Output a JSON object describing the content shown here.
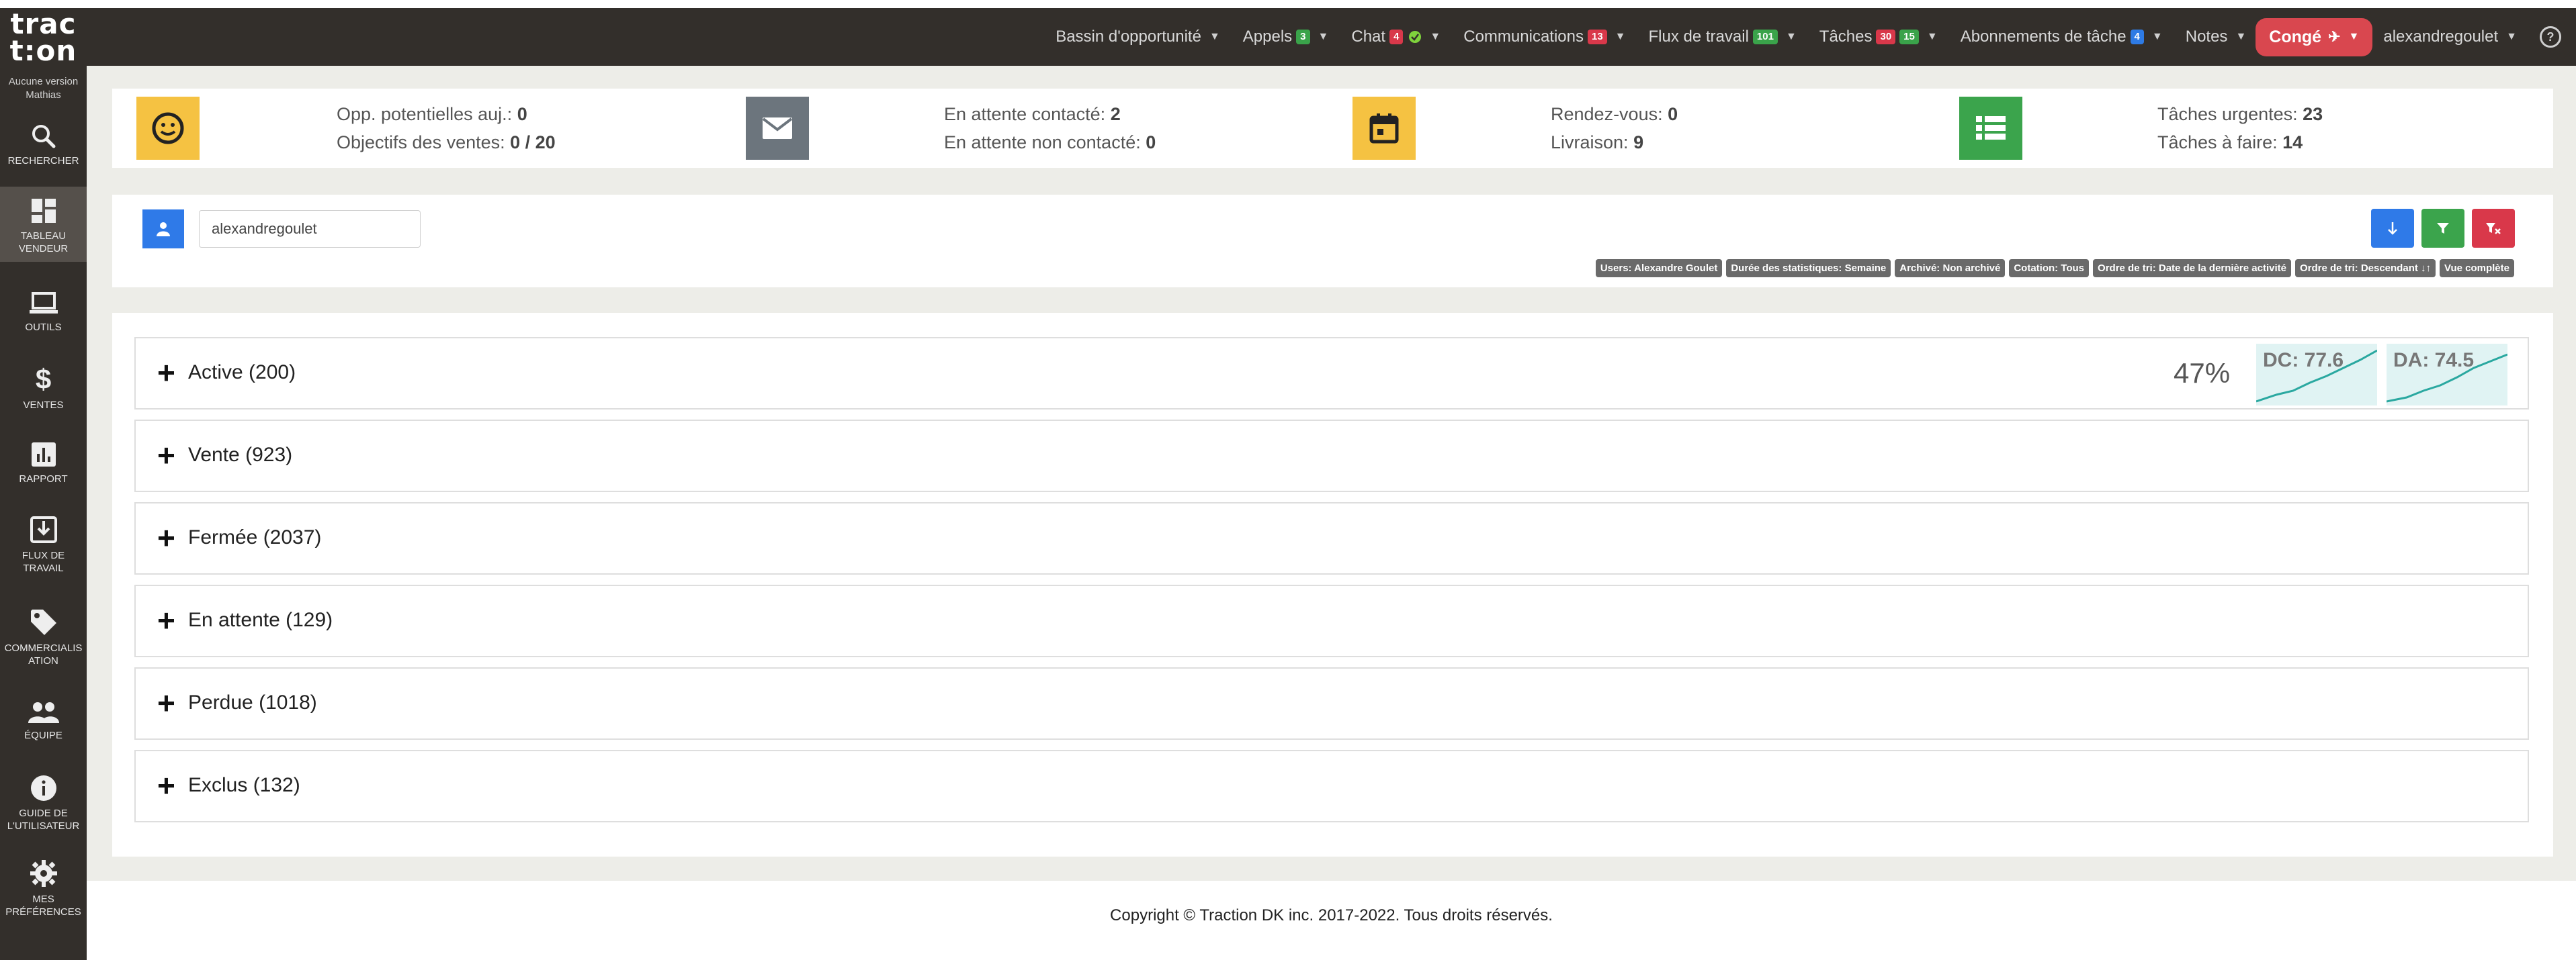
{
  "app": {
    "logo_top": "trac",
    "logo_bottom": "t:on",
    "version": "Aucune version",
    "version_user": "Mathias"
  },
  "nav": {
    "bassin": "Bassin d'opportunité",
    "appels": "Appels",
    "appels_badge": "3",
    "chat": "Chat",
    "chat_badge": "4",
    "communications": "Communications",
    "communications_badge": "13",
    "flux": "Flux de travail",
    "flux_badge": "101",
    "taches": "Tâches",
    "taches_badge_red": "30",
    "taches_badge_green": "15",
    "abonnements": "Abonnements de tâche",
    "abonnements_badge": "4",
    "notes": "Notes",
    "conge": "Congé",
    "user": "alexandregoulet",
    "help": "?"
  },
  "sidebar": {
    "items": [
      {
        "label1": "RECHERCHER",
        "label2": ""
      },
      {
        "label1": "TABLEAU",
        "label2": "VENDEUR"
      },
      {
        "label1": "OUTILS",
        "label2": ""
      },
      {
        "label1": "VENTES",
        "label2": ""
      },
      {
        "label1": "RAPPORT",
        "label2": ""
      },
      {
        "label1": "FLUX DE",
        "label2": "TRAVAIL"
      },
      {
        "label1": "COMMERCIALIS",
        "label2": "ATION"
      },
      {
        "label1": "ÉQUIPE",
        "label2": ""
      },
      {
        "label1": "GUIDE DE",
        "label2": "L'UTILISATEUR"
      },
      {
        "label1": "MES",
        "label2": "PRÉFÉRENCES"
      }
    ]
  },
  "stats": {
    "opp_label": "Opp. potentielles auj.:",
    "opp_value": "0",
    "obj_label": "Objectifs des ventes:",
    "obj_value": "0 / 20",
    "contacted_label": "En attente contacté:",
    "contacted_value": "2",
    "not_contacted_label": "En attente non contacté:",
    "not_contacted_value": "0",
    "rdv_label": "Rendez-vous:",
    "rdv_value": "0",
    "livraison_label": "Livraison:",
    "livraison_value": "9",
    "urgent_label": "Tâches urgentes:",
    "urgent_value": "23",
    "todo_label": "Tâches à faire:",
    "todo_value": "14",
    "colors": {
      "yellow": "#f5c242",
      "gray": "#6c757d",
      "green": "#3ba44c"
    }
  },
  "filter": {
    "username": "alexandregoulet",
    "chips": [
      "Users: Alexandre Goulet",
      "Durée des statistiques: Semaine",
      "Archivé: Non archivé",
      "Cotation: Tous",
      "Ordre de tri: Date de la dernière activité",
      "Ordre de tri: Descendant ↓↑",
      "Vue complète"
    ]
  },
  "groups": [
    {
      "label": "Active (200)"
    },
    {
      "label": "Vente (923)"
    },
    {
      "label": "Fermée (2037)"
    },
    {
      "label": "En attente (129)"
    },
    {
      "label": "Perdue (1018)"
    },
    {
      "label": "Exclus (132)"
    }
  ],
  "active_metrics": {
    "percent": "47%",
    "dc": "DC: 77.6",
    "da": "DA: 74.5"
  },
  "footer": "Copyright © Traction DK inc. 2017-2022. Tous droits réservés."
}
